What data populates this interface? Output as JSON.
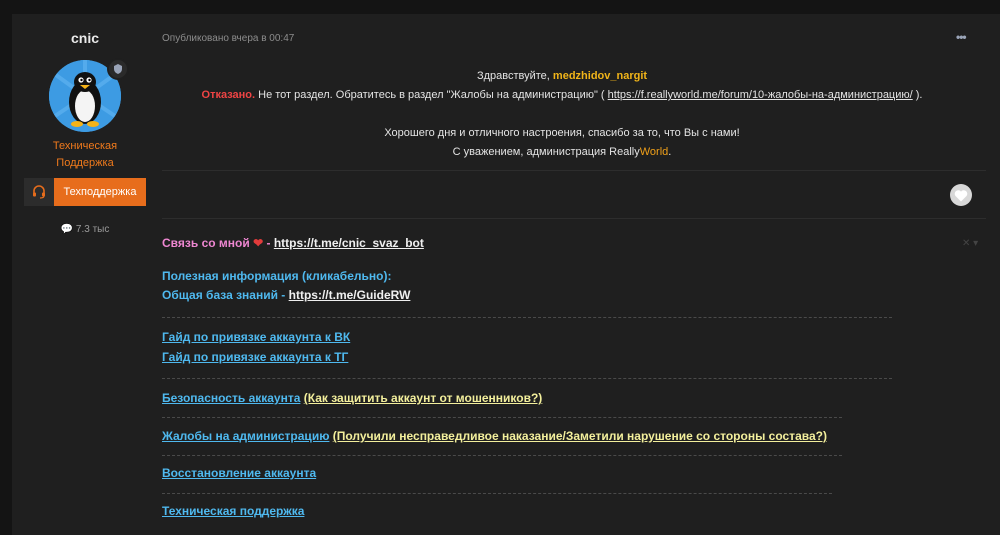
{
  "user": {
    "name": "cnic",
    "title_line1": "Техническая",
    "title_line2": "Поддержка",
    "banner": "Техподдержка",
    "messages": "7.3 тыс"
  },
  "post": {
    "date": "Опубликовано вчера в 00:47",
    "menu": "•••",
    "greeting": "Здравствуйте,",
    "nick": "medzhidov_nargit",
    "rejected": "Отказано.",
    "reason": "Не тот раздел. Обратитесь в раздел \"Жалобы на администрацию\" (",
    "link": "https://f.reallyworld.me/forum/10-жалобы-на-администрацию/",
    "reason_end": ").",
    "wish": "Хорошего дня и отличного настроения, спасибо за то, что Вы с нами!",
    "regards": "С уважением, администрация Really",
    "world": "World",
    "regards_end": "."
  },
  "signature": {
    "contact_label": "Связь со мной",
    "contact_heart": "❤",
    "contact_dash": "-",
    "contact_link": "https://t.me/cnic_svaz_bot",
    "useful": "Полезная информация (кликабельно):",
    "kb_label": "Общая база знаний -",
    "kb_link": "https://t.me/GuideRW",
    "guide_vk": "Гайд по привязке аккаунта к ВК",
    "guide_tg": "Гайд по привязке аккаунта к ТГ",
    "security": "Безопасность аккаунта",
    "security_note": "(Как защитить аккаунт от мошенников?)",
    "complaints": "Жалобы на администрацию",
    "complaints_note": "(Получили несправедливое наказание/Заметили нарушение со стороны состава?)",
    "recovery": "Восстановление аккаунта",
    "support": "Техническая поддержка"
  }
}
